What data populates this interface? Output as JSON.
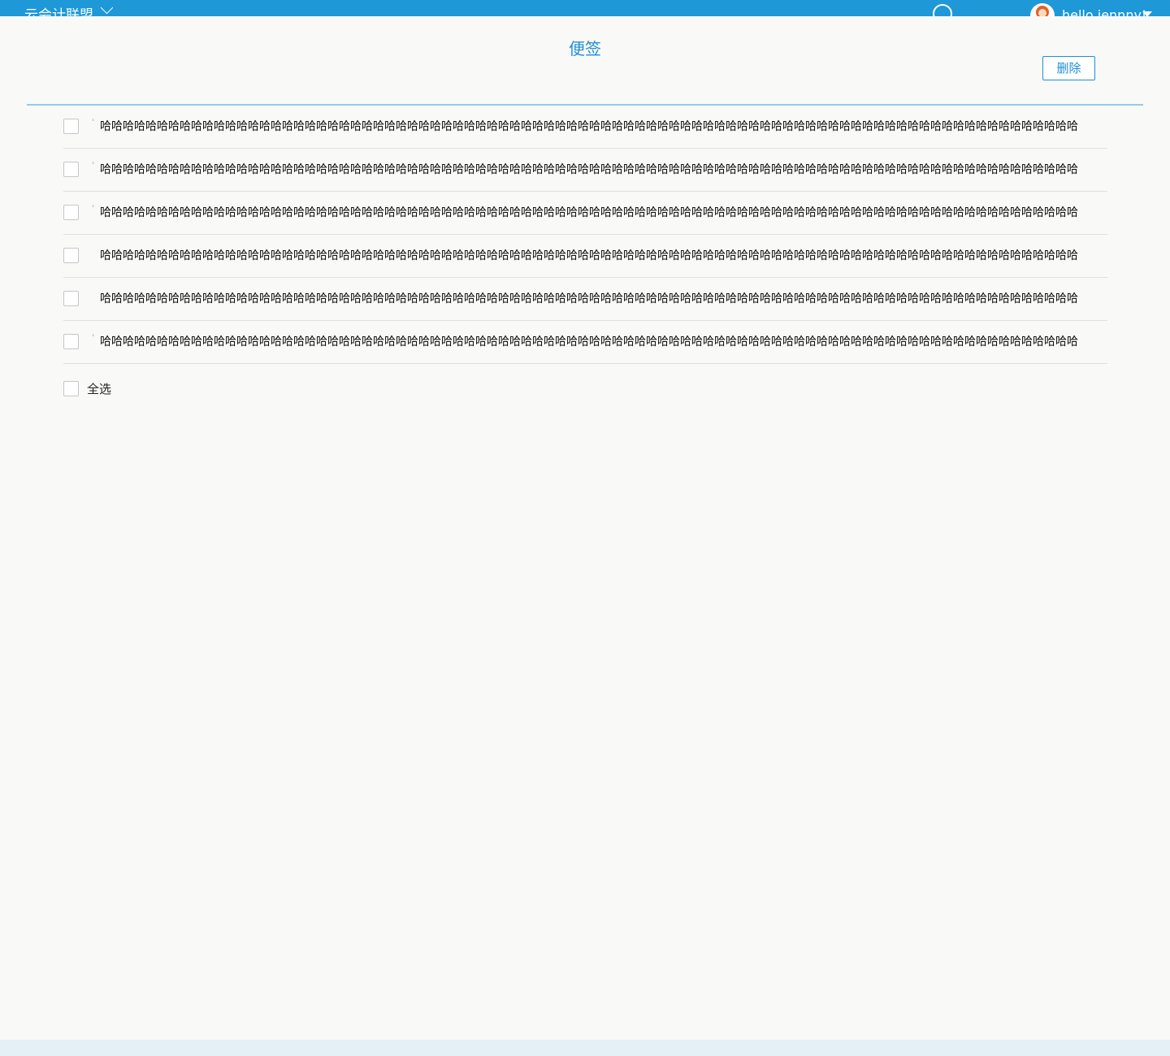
{
  "header": {
    "brand": "云会计联盟",
    "username": "hello,jennny!"
  },
  "page": {
    "title": "便签",
    "delete_label": "删除"
  },
  "notes": [
    {
      "text": "哈哈哈哈哈哈哈哈哈哈哈哈哈哈哈哈哈哈哈哈哈哈哈哈哈哈哈哈哈哈哈哈哈哈哈哈哈哈哈哈哈哈哈哈哈哈哈哈哈哈哈哈哈哈哈哈哈哈哈哈哈哈哈哈哈哈哈哈哈哈哈哈哈哈哈哈哈哈哈哈哈哈哈哈哈哈",
      "checked": false
    },
    {
      "text": "哈哈哈哈哈哈哈哈哈哈哈哈哈哈哈哈哈哈哈哈哈哈哈哈哈哈哈哈哈哈哈哈哈哈哈哈哈哈哈哈哈哈哈哈哈哈哈哈哈哈哈哈哈哈哈哈哈哈哈哈哈哈哈哈哈哈哈哈哈哈哈哈哈哈哈哈哈哈哈哈哈哈哈哈哈哈",
      "checked": false
    },
    {
      "text": "哈哈哈哈哈哈哈哈哈哈哈哈哈哈哈哈哈哈哈哈哈哈哈哈哈哈哈哈哈哈哈哈哈哈哈哈哈哈哈哈哈哈哈哈哈哈哈哈哈哈哈哈哈哈哈哈哈哈哈哈哈哈哈哈哈哈哈哈哈哈哈哈哈哈哈哈哈哈哈哈哈哈哈哈哈哈",
      "checked": false
    },
    {
      "text": "哈哈哈哈哈哈哈哈哈哈哈哈哈哈哈哈哈哈哈哈哈哈哈哈哈哈哈哈哈哈哈哈哈哈哈哈哈哈哈哈哈哈哈哈哈哈哈哈哈哈哈哈哈哈哈哈哈哈哈哈哈哈哈哈哈哈哈哈哈哈哈哈哈哈哈哈哈哈哈哈哈哈哈哈哈哈",
      "checked": false
    },
    {
      "text": "哈哈哈哈哈哈哈哈哈哈哈哈哈哈哈哈哈哈哈哈哈哈哈哈哈哈哈哈哈哈哈哈哈哈哈哈哈哈哈哈哈哈哈哈哈哈哈哈哈哈哈哈哈哈哈哈哈哈哈哈哈哈哈哈哈哈哈哈哈哈哈哈哈哈哈哈哈哈哈哈哈哈哈哈哈哈",
      "checked": false
    },
    {
      "text": "哈哈哈哈哈哈哈哈哈哈哈哈哈哈哈哈哈哈哈哈哈哈哈哈哈哈哈哈哈哈哈哈哈哈哈哈哈哈哈哈哈哈哈哈哈哈哈哈哈哈哈哈哈哈哈哈哈哈哈哈哈哈哈哈哈哈哈哈哈哈哈哈哈哈哈哈哈哈哈哈哈哈哈哈哈哈",
      "checked": false
    }
  ],
  "select_all": {
    "label": "全选",
    "checked": false
  },
  "colors": {
    "accent": "#1e8fd3",
    "topbar": "#1e98d6",
    "panel_bg": "#f9f9f7",
    "page_bg": "#e4f0f6"
  },
  "icons": {
    "brand_dropdown": "chevron-down-icon",
    "search": "search-icon",
    "user_menu": "caret-down-icon"
  }
}
